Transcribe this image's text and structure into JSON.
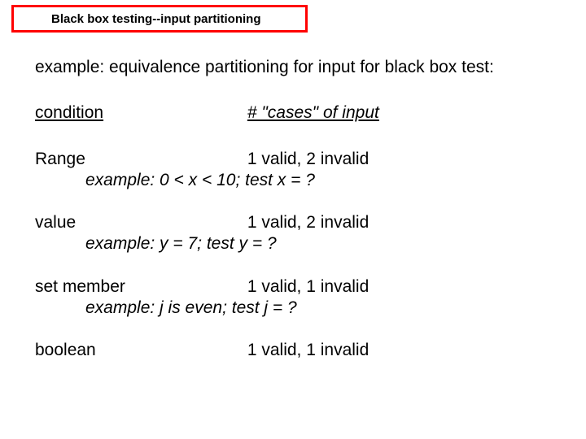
{
  "title": "Black box testing--input partitioning",
  "intro": "example:  equivalence partitioning for input for black box test:",
  "headers": {
    "col1": "condition",
    "col2": "# \"cases\" of input"
  },
  "blocks": [
    {
      "col1": "Range",
      "col2": "1 valid, 2 invalid",
      "example": "example: 0 < x < 10; test x = ?"
    },
    {
      "col1": "value",
      "col2": "1 valid, 2 invalid",
      "example": "example: y = 7; test y = ?"
    },
    {
      "col1": "set member",
      "col2": "1 valid, 1 invalid",
      "example": "example: j is even; test j = ?"
    },
    {
      "col1": "boolean",
      "col2": "1 valid, 1 invalid",
      "example": null
    }
  ]
}
